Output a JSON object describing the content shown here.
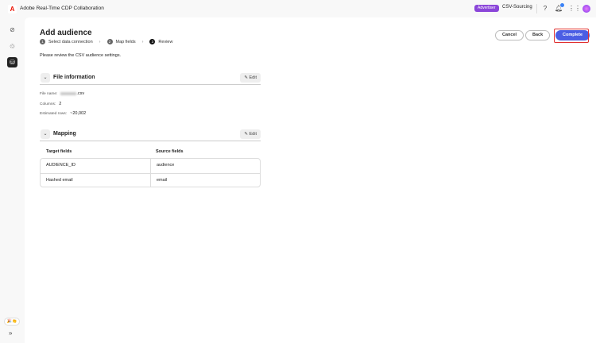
{
  "header": {
    "app_title": "Adobe Real-Time CDP Collaboration",
    "role_badge": "Advertiser",
    "org_name": "CSV-Sourcing",
    "colors": {
      "badge": "#8b46d9",
      "accent": "#4b5ee4"
    }
  },
  "page": {
    "title": "Add audience",
    "steps": [
      {
        "num": "1",
        "label": "Select data connection"
      },
      {
        "num": "2",
        "label": "Map fields"
      },
      {
        "num": "3",
        "label": "Review"
      }
    ],
    "intro": "Please review the CSV audience settings.",
    "buttons": {
      "cancel": "Cancel",
      "back": "Back",
      "complete": "Complete"
    }
  },
  "file_info": {
    "title": "File information",
    "edit": "Edit",
    "file_name_label": "File name:",
    "file_name_suffix": ".csv",
    "columns_label": "Columns:",
    "columns": "2",
    "rows_label": "Estimated rows:",
    "rows": "~20,002"
  },
  "mapping": {
    "title": "Mapping",
    "edit": "Edit",
    "headers": [
      "Target fields",
      "Source fields"
    ],
    "rows": [
      [
        "AUDIENCE_ID",
        "audience"
      ],
      [
        "Hashed email",
        "email"
      ]
    ]
  },
  "sidebar": {
    "feedback": "🎉👏",
    "expand": "»"
  }
}
